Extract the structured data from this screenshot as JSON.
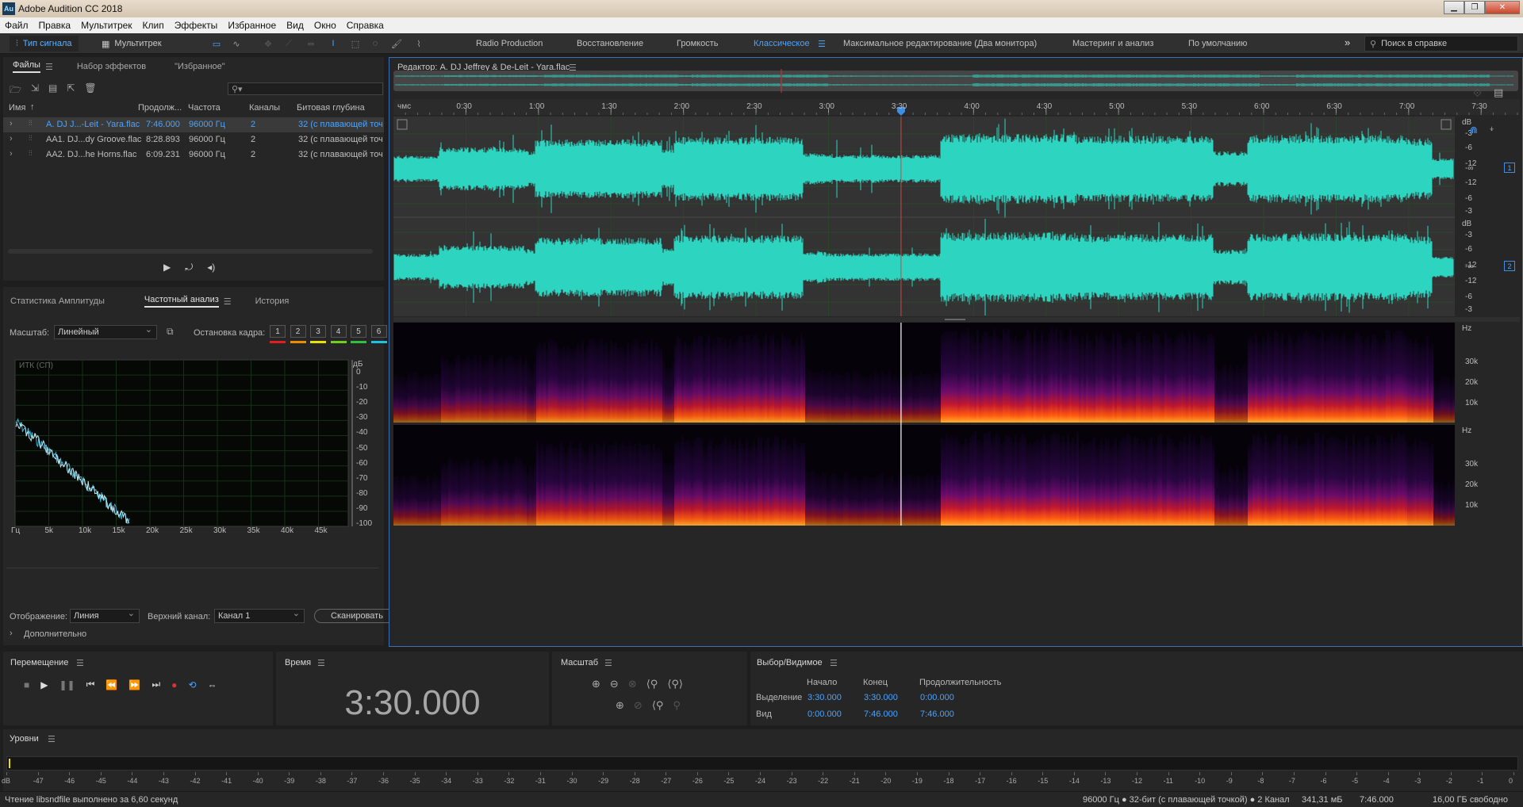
{
  "window": {
    "title": "Adobe Audition CC 2018",
    "app_icon": "Au"
  },
  "menu": [
    "Файл",
    "Правка",
    "Мультитрек",
    "Клип",
    "Эффекты",
    "Избранное",
    "Вид",
    "Окно",
    "Справка"
  ],
  "toolbar": {
    "waveform_mode": "Тип сигнала",
    "multitrack_mode": "Мультитрек",
    "workspaces": [
      "Radio Production",
      "Восстановление",
      "Громкость",
      "Классическое",
      "Максимальное редактирование (Два монитора)",
      "Мастеринг и анализ",
      "По умолчанию"
    ],
    "active_workspace": "Классическое",
    "search_placeholder": "Поиск в справке"
  },
  "files_panel": {
    "tabs": [
      "Файлы",
      "Набор эффектов",
      "\"Избранное\""
    ],
    "search_value": "",
    "columns": [
      "Имя",
      "Продолж...",
      "Частота",
      "Каналы",
      "Битовая глубина"
    ],
    "rows": [
      {
        "name": "A. DJ J...-Leit - Yara.flac",
        "duration": "7:46.000",
        "rate": "96000 Гц",
        "channels": "2",
        "depth": "32 (с плавающей точ",
        "selected": true
      },
      {
        "name": "AA1. DJ...dy Groove.flac",
        "duration": "8:28.893",
        "rate": "96000 Гц",
        "channels": "2",
        "depth": "32 (с плавающей точ",
        "selected": false
      },
      {
        "name": "AA2. DJ...he Horns.flac",
        "duration": "6:09.231",
        "rate": "96000 Гц",
        "channels": "2",
        "depth": "32 (с плавающей точ",
        "selected": false
      }
    ]
  },
  "freq_panel": {
    "tabs": [
      "Статистика Амплитуды",
      "Частотный анализ",
      "История"
    ],
    "scale_label": "Масштаб:",
    "scale_value": "Линейный",
    "freeze_label": "Остановка кадра:",
    "frames": [
      "1",
      "2",
      "3",
      "4",
      "5",
      "6"
    ],
    "frame_colors": [
      "#e02020",
      "#f08a00",
      "#e8e000",
      "#70d020",
      "#30c040",
      "#20c0e0"
    ],
    "graph_label": "ИТК (СП)",
    "db_unit": "дБ",
    "db_ticks": [
      "0",
      "-10",
      "-20",
      "-30",
      "-40",
      "-50",
      "-60",
      "-70",
      "-80",
      "-90",
      "-100"
    ],
    "hz_ticks": [
      "Гц",
      "5k",
      "10k",
      "15k",
      "20k",
      "25k",
      "30k",
      "35k",
      "40k",
      "45k"
    ],
    "display_label": "Отображение:",
    "display_value": "Линия",
    "top_channel_label": "Верхний канал:",
    "top_channel_value": "Канал 1",
    "scan_button": "Сканировать",
    "advanced": "Дополнительно"
  },
  "editor": {
    "title": "Редактор: A. DJ Jeffrey & De-Leit - Yara.flac",
    "ruler_unit": "чмс",
    "ruler": [
      "0:30",
      "1:00",
      "1:30",
      "2:00",
      "2:30",
      "3:00",
      "3:30",
      "4:00",
      "4:30",
      "5:00",
      "5:30",
      "6:00",
      "6:30",
      "7:00",
      "7:30"
    ],
    "total_seconds": 466,
    "playhead_seconds": 210,
    "amp_unit": "dB",
    "amp_ticks": [
      "-3",
      "-6",
      "-12",
      "-∞",
      "-12",
      "-6",
      "-3"
    ],
    "channels": [
      "1",
      "2"
    ],
    "spec_unit": "Hz",
    "spec_ticks": [
      "30k",
      "20k",
      "10k"
    ],
    "wave_color": "#2dd4bf"
  },
  "transport": {
    "title": "Перемещение"
  },
  "time_panel": {
    "title": "Время",
    "value": "3:30.000"
  },
  "zoom_panel": {
    "title": "Масштаб"
  },
  "selection_panel": {
    "title": "Выбор/Видимое",
    "headers": [
      "Начало",
      "Конец",
      "Продолжительность"
    ],
    "rows": [
      {
        "label": "Выделение",
        "start": "3:30.000",
        "end": "3:30.000",
        "duration": "0:00.000"
      },
      {
        "label": "Вид",
        "start": "0:00.000",
        "end": "7:46.000",
        "duration": "7:46.000"
      }
    ]
  },
  "levels": {
    "title": "Уровни",
    "scale": [
      "dB",
      "-47",
      "-46",
      "-45",
      "-44",
      "-43",
      "-42",
      "-41",
      "-40",
      "-39",
      "-38",
      "-37",
      "-36",
      "-35",
      "-34",
      "-33",
      "-32",
      "-31",
      "-30",
      "-29",
      "-28",
      "-27",
      "-26",
      "-25",
      "-24",
      "-23",
      "-22",
      "-21",
      "-20",
      "-19",
      "-18",
      "-17",
      "-16",
      "-15",
      "-14",
      "-13",
      "-12",
      "-11",
      "-10",
      "-9",
      "-8",
      "-7",
      "-6",
      "-5",
      "-4",
      "-3",
      "-2",
      "-1",
      "0"
    ]
  },
  "status": {
    "left": "Чтение libsndfile выполнено за 6,60 секунд",
    "format": "96000 Гц ● 32-бит (с плавающей точкой) ● 2 Канал",
    "size": "341,31 мБ",
    "duration": "7:46.000",
    "free": "16,00 ГБ свободно"
  }
}
